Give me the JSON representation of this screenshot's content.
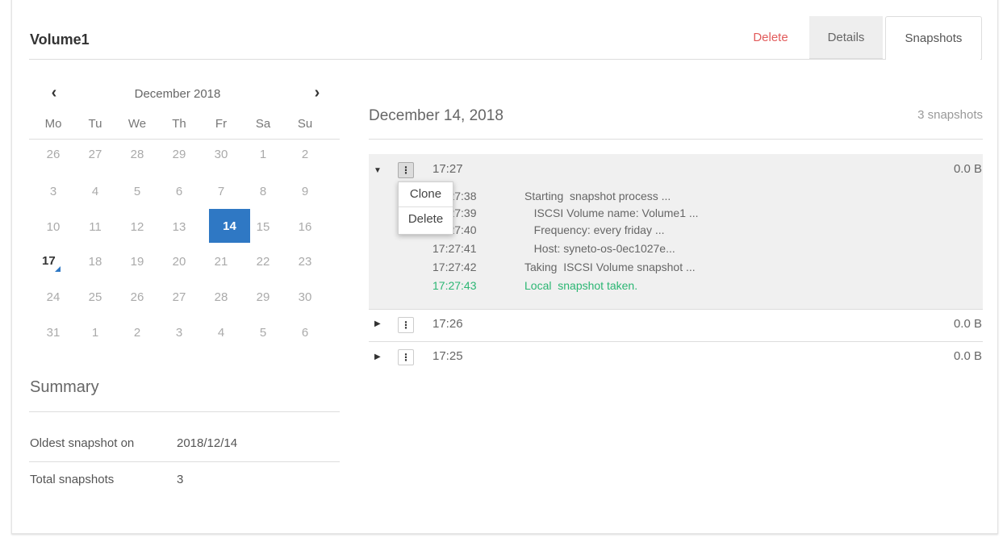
{
  "volume": {
    "title": "Volume1"
  },
  "header": {
    "delete_label": "Delete",
    "tabs": [
      "Details",
      "Snapshots"
    ],
    "active_tab": "Snapshots"
  },
  "calendar": {
    "month_label": "December 2018",
    "prev_icon": "‹",
    "next_icon": "›",
    "weekdays": [
      "Mo",
      "Tu",
      "We",
      "Th",
      "Fr",
      "Sa",
      "Su"
    ],
    "weeks": [
      [
        "26",
        "27",
        "28",
        "29",
        "30",
        "1",
        "2"
      ],
      [
        "3",
        "4",
        "5",
        "6",
        "7",
        "8",
        "9"
      ],
      [
        "10",
        "11",
        "12",
        "13",
        "14",
        "15",
        "16"
      ],
      [
        "17",
        "18",
        "19",
        "20",
        "21",
        "22",
        "23"
      ],
      [
        "24",
        "25",
        "26",
        "27",
        "28",
        "29",
        "30"
      ],
      [
        "31",
        "1",
        "2",
        "3",
        "4",
        "5",
        "6"
      ]
    ],
    "selected_day": "14",
    "today": "17",
    "accent_color": "#2f78c4"
  },
  "summary": {
    "title": "Summary",
    "oldest_label": "Oldest snapshot on",
    "oldest_value": "2018/12/14",
    "total_label": "Total snapshots",
    "total_value": "3"
  },
  "day": {
    "title": "December 14, 2018",
    "count_label": "3 snapshots"
  },
  "snapshots": [
    {
      "time": "17:27",
      "size": "0.0 B",
      "expanded": true,
      "log": [
        {
          "time": "17:27:38",
          "message": "Starting  snapshot process ..."
        },
        {
          "time": "17:27:39",
          "message": "   ISCSI Volume name: Volume1 ..."
        },
        {
          "time": "17:27:40",
          "message": "   Frequency: every friday ..."
        },
        {
          "time": "17:27:41",
          "message": "   Host: syneto-os-0ec1027e..."
        },
        {
          "time": "17:27:42",
          "message": "Taking  ISCSI Volume snapshot ..."
        },
        {
          "time": "17:27:43",
          "message": "Local  snapshot taken.",
          "status": "success"
        }
      ]
    },
    {
      "time": "17:26",
      "size": "0.0 B",
      "expanded": false
    },
    {
      "time": "17:25",
      "size": "0.0 B",
      "expanded": false
    }
  ],
  "context_menu": {
    "items": [
      "Clone",
      "Delete"
    ]
  },
  "colors": {
    "danger": "#e25b5b",
    "success": "#2bb673",
    "expanded_bg": "#f0f0f0"
  }
}
